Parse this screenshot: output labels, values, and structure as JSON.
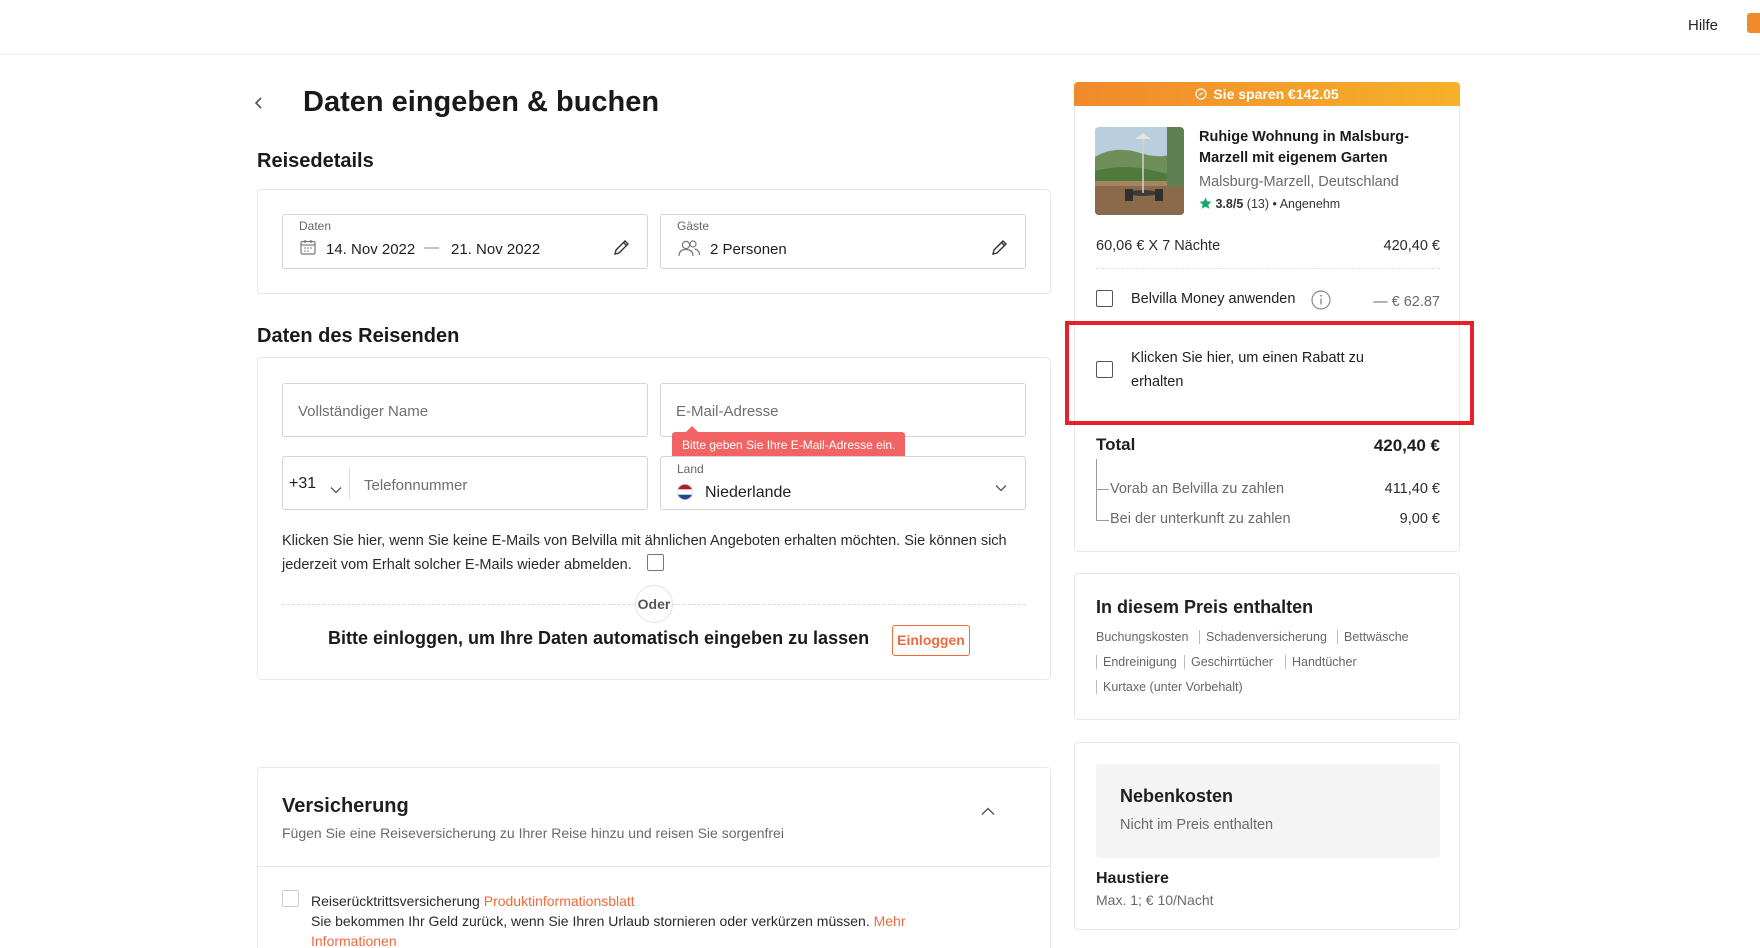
{
  "header": {
    "help_label": "Hilfe"
  },
  "page": {
    "title": "Daten eingeben & buchen"
  },
  "trip_details": {
    "section_title": "Reisedetails",
    "dates": {
      "label": "Daten",
      "start": "14. Nov 2022",
      "separator": "—",
      "end": "21. Nov 2022"
    },
    "guests": {
      "label": "Gäste",
      "value": "2 Personen"
    }
  },
  "traveler": {
    "section_title": "Daten des Reisenden",
    "name_placeholder": "Vollständiger Name",
    "email_placeholder": "E-Mail-Adresse",
    "email_error": "Bitte geben Sie Ihre E-Mail-Adresse ein.",
    "phone_prefix": "+31",
    "phone_placeholder": "Telefonnummer",
    "country": {
      "label": "Land",
      "value": "Niederlande"
    },
    "consent_text": "Klicken Sie hier, wenn Sie keine E-Mails von Belvilla mit ähnlichen Angeboten erhalten möchten. Sie können sich jederzeit vom Erhalt solcher E-Mails wieder abmelden.",
    "or_label": "Oder",
    "login_prompt": "Bitte einloggen, um Ihre Daten automatisch eingeben zu lassen",
    "login_button": "Einloggen"
  },
  "insurance": {
    "title": "Versicherung",
    "subtitle": "Fügen Sie eine Reiseversicherung zu Ihrer Reise hinzu und reisen Sie sorgenfrei",
    "item_title": "Reiserücktrittsversicherung",
    "item_link": "Produktinformationsblatt",
    "item_desc": "Sie bekommen Ihr Geld zurück, wenn Sie Ihren Urlaub stornieren oder verkürzen müssen.",
    "item_more": "Mehr Informationen"
  },
  "summary": {
    "savings": "Sie sparen €142.05",
    "property_title": "Ruhige Wohnung in Malsburg-Marzell mit eigenem Garten",
    "location": "Malsburg-Marzell, Deutschland",
    "rating": "3.8/5",
    "reviews": "(13)",
    "rating_label": "Angenehm",
    "nights_label": "60,06 € X 7 Nächte",
    "nights_value": "420,40 €",
    "money_label": "Belvilla Money anwenden",
    "money_value": "— € 62.87",
    "discount_label": "Klicken Sie hier, um einen Rabatt zu erhalten",
    "total_label": "Total",
    "total_value": "420,40 €",
    "prepay_label": "Vorab an Belvilla zu zahlen",
    "prepay_value": "411,40 €",
    "onsite_label": "Bei der unterkunft zu zahlen",
    "onsite_value": "9,00 €"
  },
  "included": {
    "title": "In diesem Preis enthalten",
    "items": [
      "Buchungskosten",
      "Schadenversicherung",
      "Bettwäsche",
      "Endreinigung",
      "Geschirrtücher",
      "Handtücher",
      "Kurtaxe (unter Vorbehalt)"
    ]
  },
  "extras": {
    "title": "Nebenkosten",
    "subtitle": "Nicht im Preis enthalten",
    "pets_title": "Haustiere",
    "pets_detail": "Max. 1; € 10/Nacht"
  },
  "colors": {
    "accent": "#ef6a3a",
    "error": "#f26464",
    "highlight": "#e8202a",
    "rating_star": "#1aa86b"
  }
}
